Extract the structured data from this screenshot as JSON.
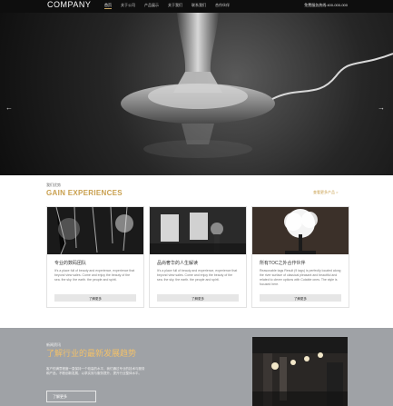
{
  "header": {
    "logo": "COMPANY",
    "nav": [
      "首页",
      "关于公司",
      "产品展示",
      "关于我们",
      "联系我们",
      "合作伙伴"
    ],
    "phone": "免费服务热线:400-000-000"
  },
  "hero": {
    "prev_icon": "arrow-left-icon",
    "next_icon": "arrow-right-icon"
  },
  "gain": {
    "subtitle": "我们优势",
    "title": "GAIN EXPERIENCES",
    "more": "查看更多产品 >",
    "cards": [
      {
        "title": "专业的数码团队",
        "desc": "It's a place full of beauty and experience, experience that beyond view sales. Come and enjoy the beauty of the sea. the sky. the earth. the people and spirit.",
        "button": "了解更多"
      },
      {
        "title": "品尚奢华的人生解读",
        "desc": "It's a place full of beauty and experience, experience that beyond view sales. Come and enjoy the beauty of the sea. the sky. the earth. the people and spirit.",
        "button": "了解更多"
      },
      {
        "title": "所有TOC之外合作伙伴",
        "desc": "Reasonable tags Result (9 tags) is perfectly located along the river surface of classical pleasant and beautiful and related to clever options with Cutable ones. The style is focused here.",
        "button": "了解更多"
      }
    ]
  },
  "trends": {
    "subtitle": "新闻资讯",
    "title": "了解行业的最新发展趋势",
    "desc": "客户的满意程度一直保持一个较高的水平，我们通过专业的技术与服务和产品，不断创新发展，以求实效与服务提升，提升行业整体水平。",
    "button": "了解更多"
  }
}
